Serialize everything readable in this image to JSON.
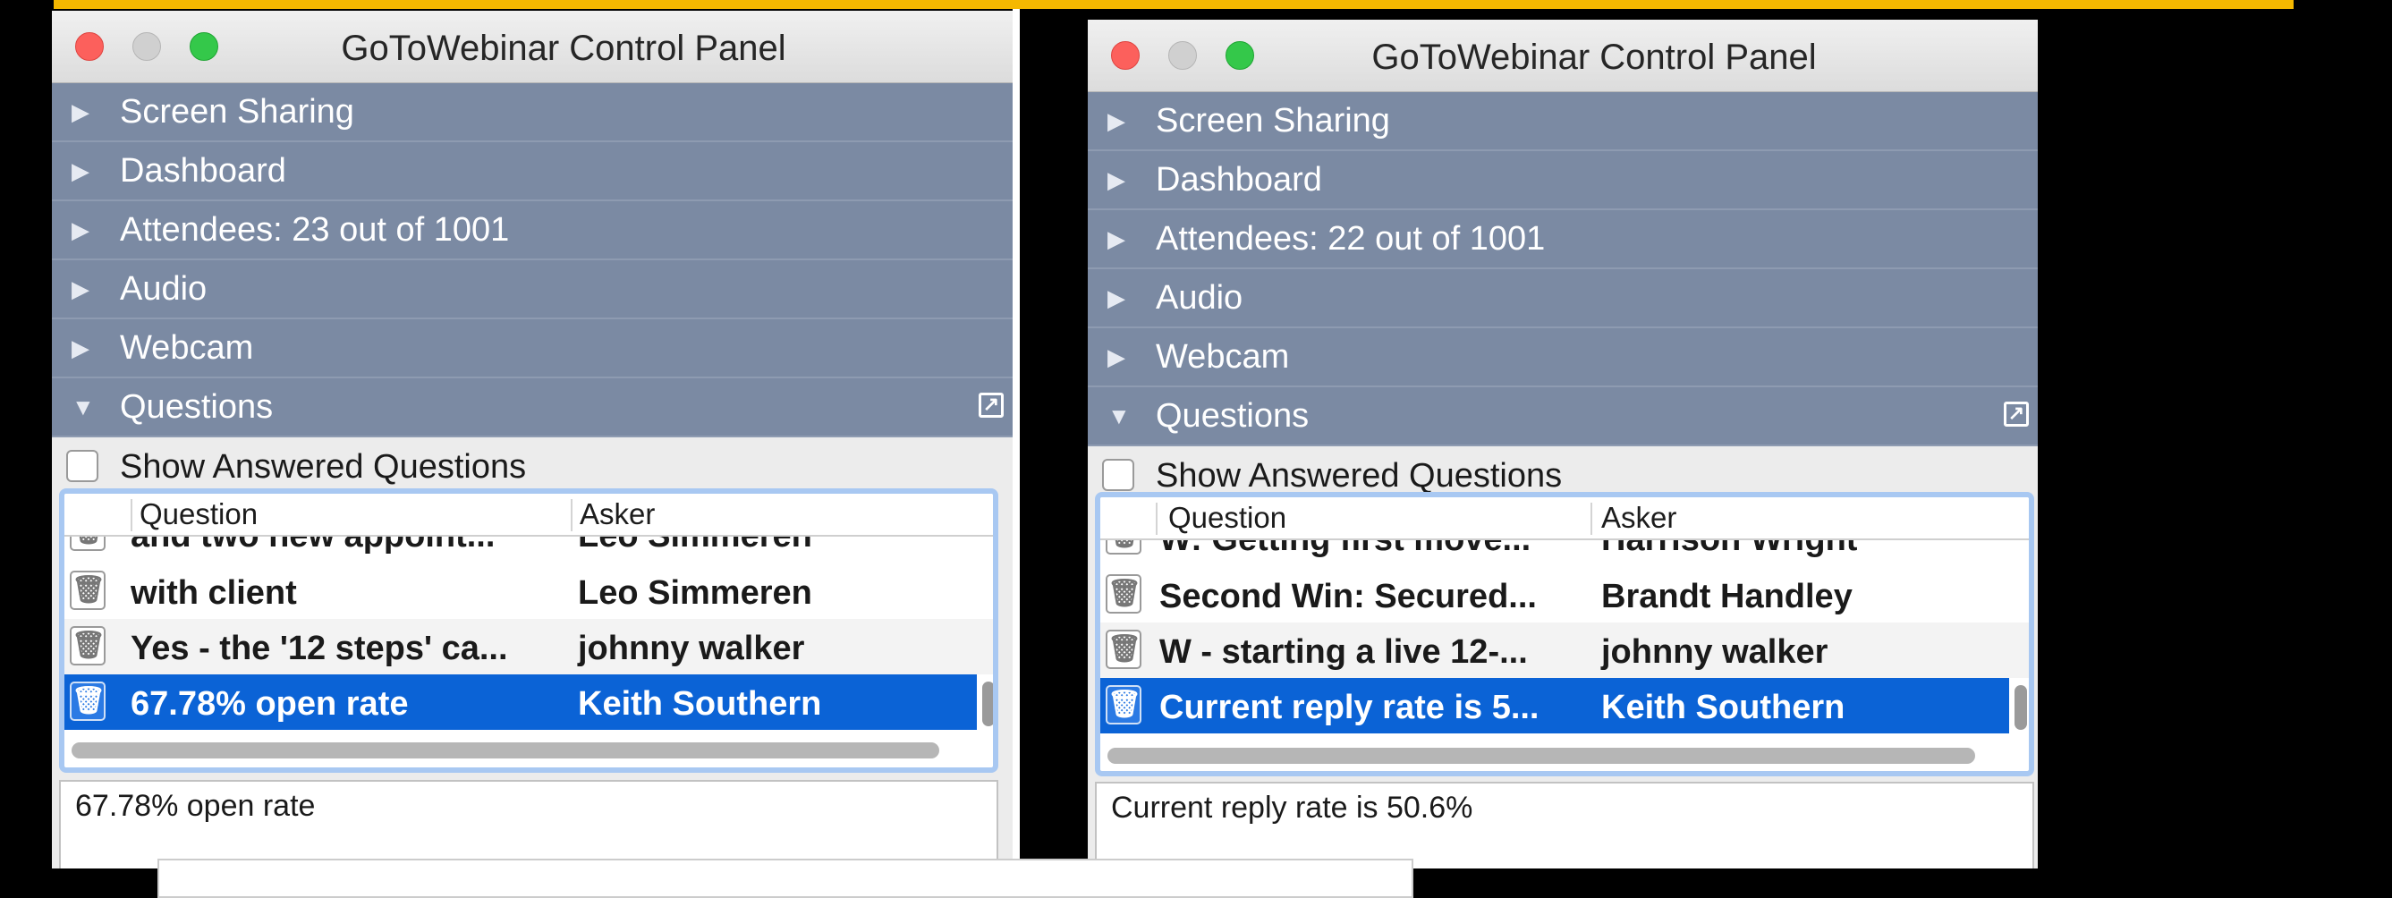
{
  "panels": [
    {
      "title": "GoToWebinar Control Panel",
      "sections": [
        {
          "label": "Screen Sharing",
          "state": "collapsed"
        },
        {
          "label": "Dashboard",
          "state": "collapsed"
        },
        {
          "label": "Attendees: 23 out of 1001",
          "state": "collapsed"
        },
        {
          "label": "Audio",
          "state": "collapsed"
        },
        {
          "label": "Webcam",
          "state": "collapsed"
        },
        {
          "label": "Questions",
          "state": "expanded"
        }
      ],
      "show_answered_label": "Show Answered Questions",
      "columns": {
        "question": "Question",
        "asker": "Asker"
      },
      "partial_row": {
        "question": "and two new appoint...",
        "asker": "Leo Simmeren"
      },
      "rows": [
        {
          "question": "with client",
          "asker": "Leo Simmeren"
        },
        {
          "question": "Yes - the '12 steps' ca...",
          "asker": "johnny walker"
        },
        {
          "question": "67.78% open rate",
          "asker": "Keith Southern",
          "selected": true
        }
      ],
      "preview": "67.78% open rate"
    },
    {
      "title": "GoToWebinar Control Panel",
      "sections": [
        {
          "label": "Screen Sharing",
          "state": "collapsed"
        },
        {
          "label": "Dashboard",
          "state": "collapsed"
        },
        {
          "label": "Attendees: 22 out of 1001",
          "state": "collapsed"
        },
        {
          "label": "Audio",
          "state": "collapsed"
        },
        {
          "label": "Webcam",
          "state": "collapsed"
        },
        {
          "label": "Questions",
          "state": "expanded"
        }
      ],
      "show_answered_label": "Show Answered Questions",
      "columns": {
        "question": "Question",
        "asker": "Asker"
      },
      "partial_row": {
        "question": "W: Getting first move...",
        "asker": "Harrison Wright"
      },
      "rows": [
        {
          "question": "Second Win: Secured...",
          "asker": "Brandt Handley"
        },
        {
          "question": "W - starting a live 12-...",
          "asker": "johnny walker"
        },
        {
          "question": "Current reply rate is 5...",
          "asker": "Keith Southern",
          "selected": true
        }
      ],
      "preview": "Current reply rate is 50.6%"
    }
  ],
  "icons": {
    "collapsed_arrow": "▶",
    "expanded_arrow": "▼",
    "trash": "🗑",
    "popout": "↗"
  },
  "colors": {
    "accent_bar": "#f5b800",
    "section_bg": "#7b8aa3",
    "selection": "#0b63d6"
  }
}
